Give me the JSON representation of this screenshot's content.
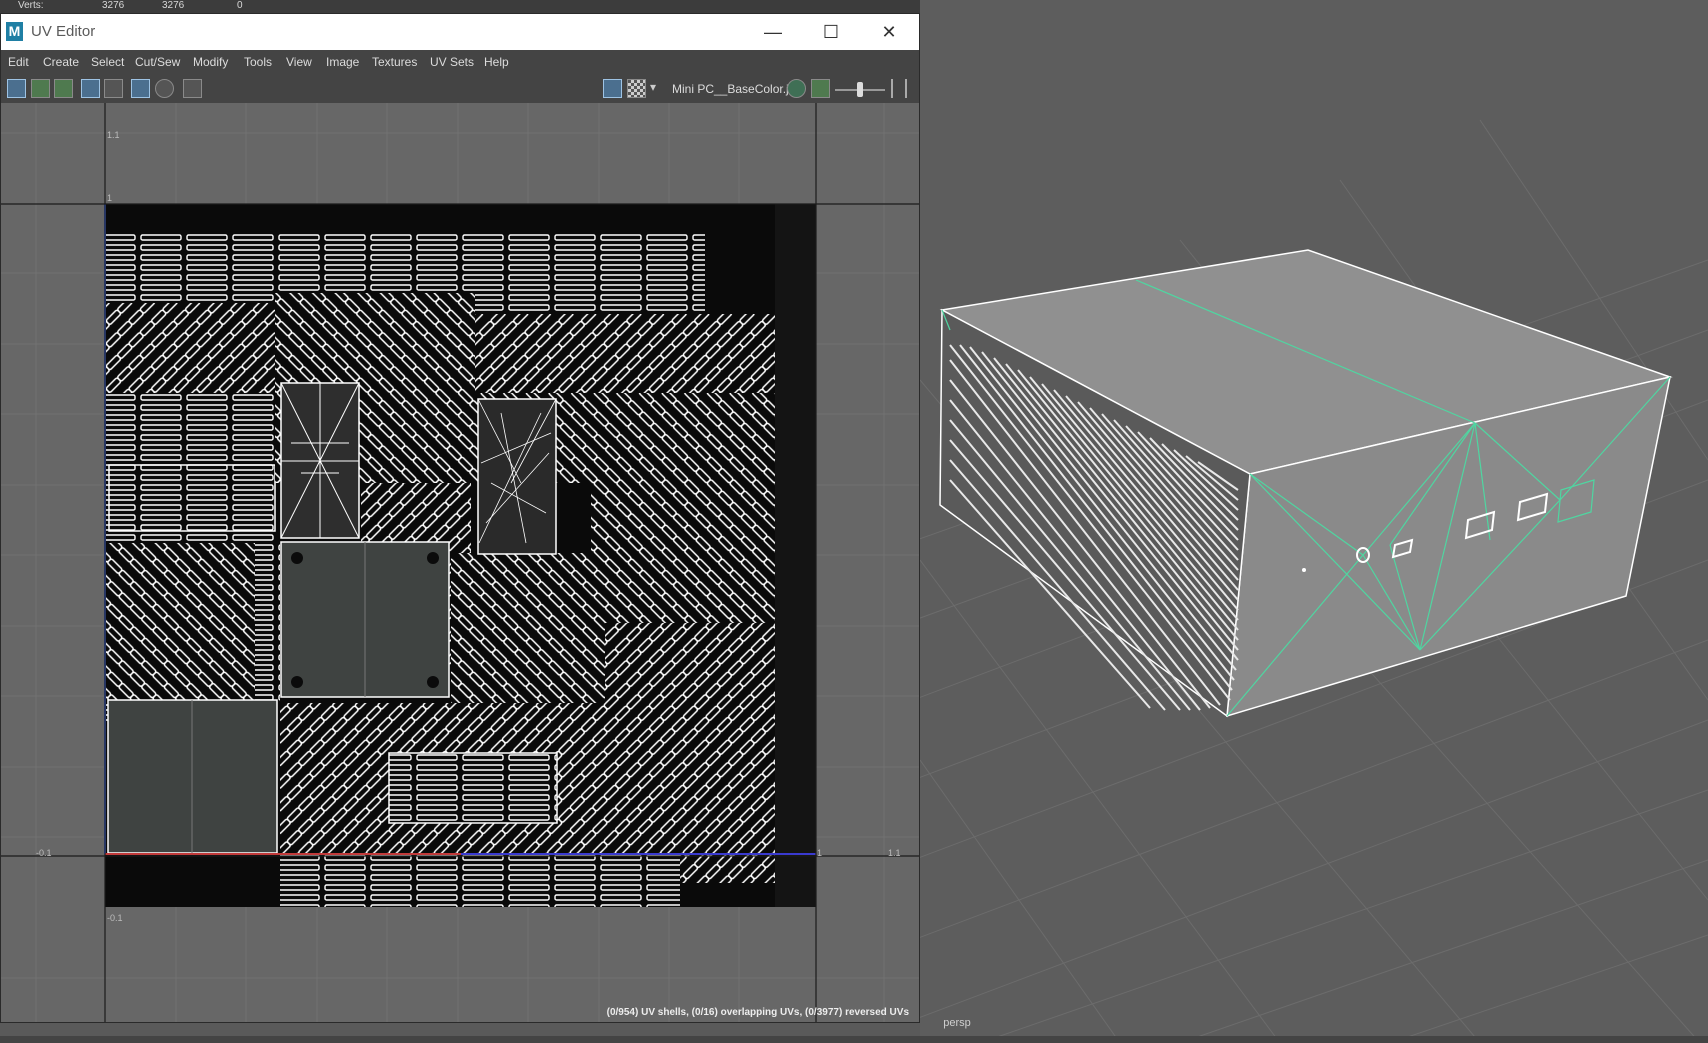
{
  "top_strip": {
    "label": "Verts:",
    "v1": "3276",
    "v2": "3276",
    "v3": "0"
  },
  "uv_editor": {
    "title": "UV Editor",
    "logo_text": "M",
    "window_buttons": {
      "minimize": "—",
      "maximize": "☐",
      "close": "✕"
    },
    "menu": [
      "Edit",
      "Create",
      "Select",
      "Cut/Sew",
      "Modify",
      "Tools",
      "View",
      "Image",
      "Textures",
      "UV Sets",
      "Help"
    ],
    "toolbar": {
      "texture_name": "Mini PC__BaseColor.j",
      "dropdown_arrow": "▾",
      "exposure_knob": 0.5
    },
    "axis_labels": {
      "top_1_1": "1.1",
      "top_1": "1",
      "left_neg": "-0.1",
      "bottom_neg": "-0.1",
      "bottom_1": "1",
      "bottom_1_1": "1.1"
    },
    "status": "(0/954) UV shells, (0/16) overlapping UVs, (0/3977) reversed UVs"
  },
  "viewport": {
    "camera_label": "persp"
  },
  "colors": {
    "accent": "#4fd6a1",
    "title_bg": "#ffffff",
    "panel": "#444444",
    "grid_bg": "#676767"
  },
  "icons": [
    "uv-shell-select-icon",
    "uv-select-icon",
    "uv-snapshot-icon",
    "frame-icon",
    "texture-icon",
    "checker-icon",
    "isolate-icon",
    "camera-icon",
    "display-image-icon",
    "checker-map-icon",
    "color-manage-icon",
    "exposure-icon",
    "gamma-icon"
  ]
}
